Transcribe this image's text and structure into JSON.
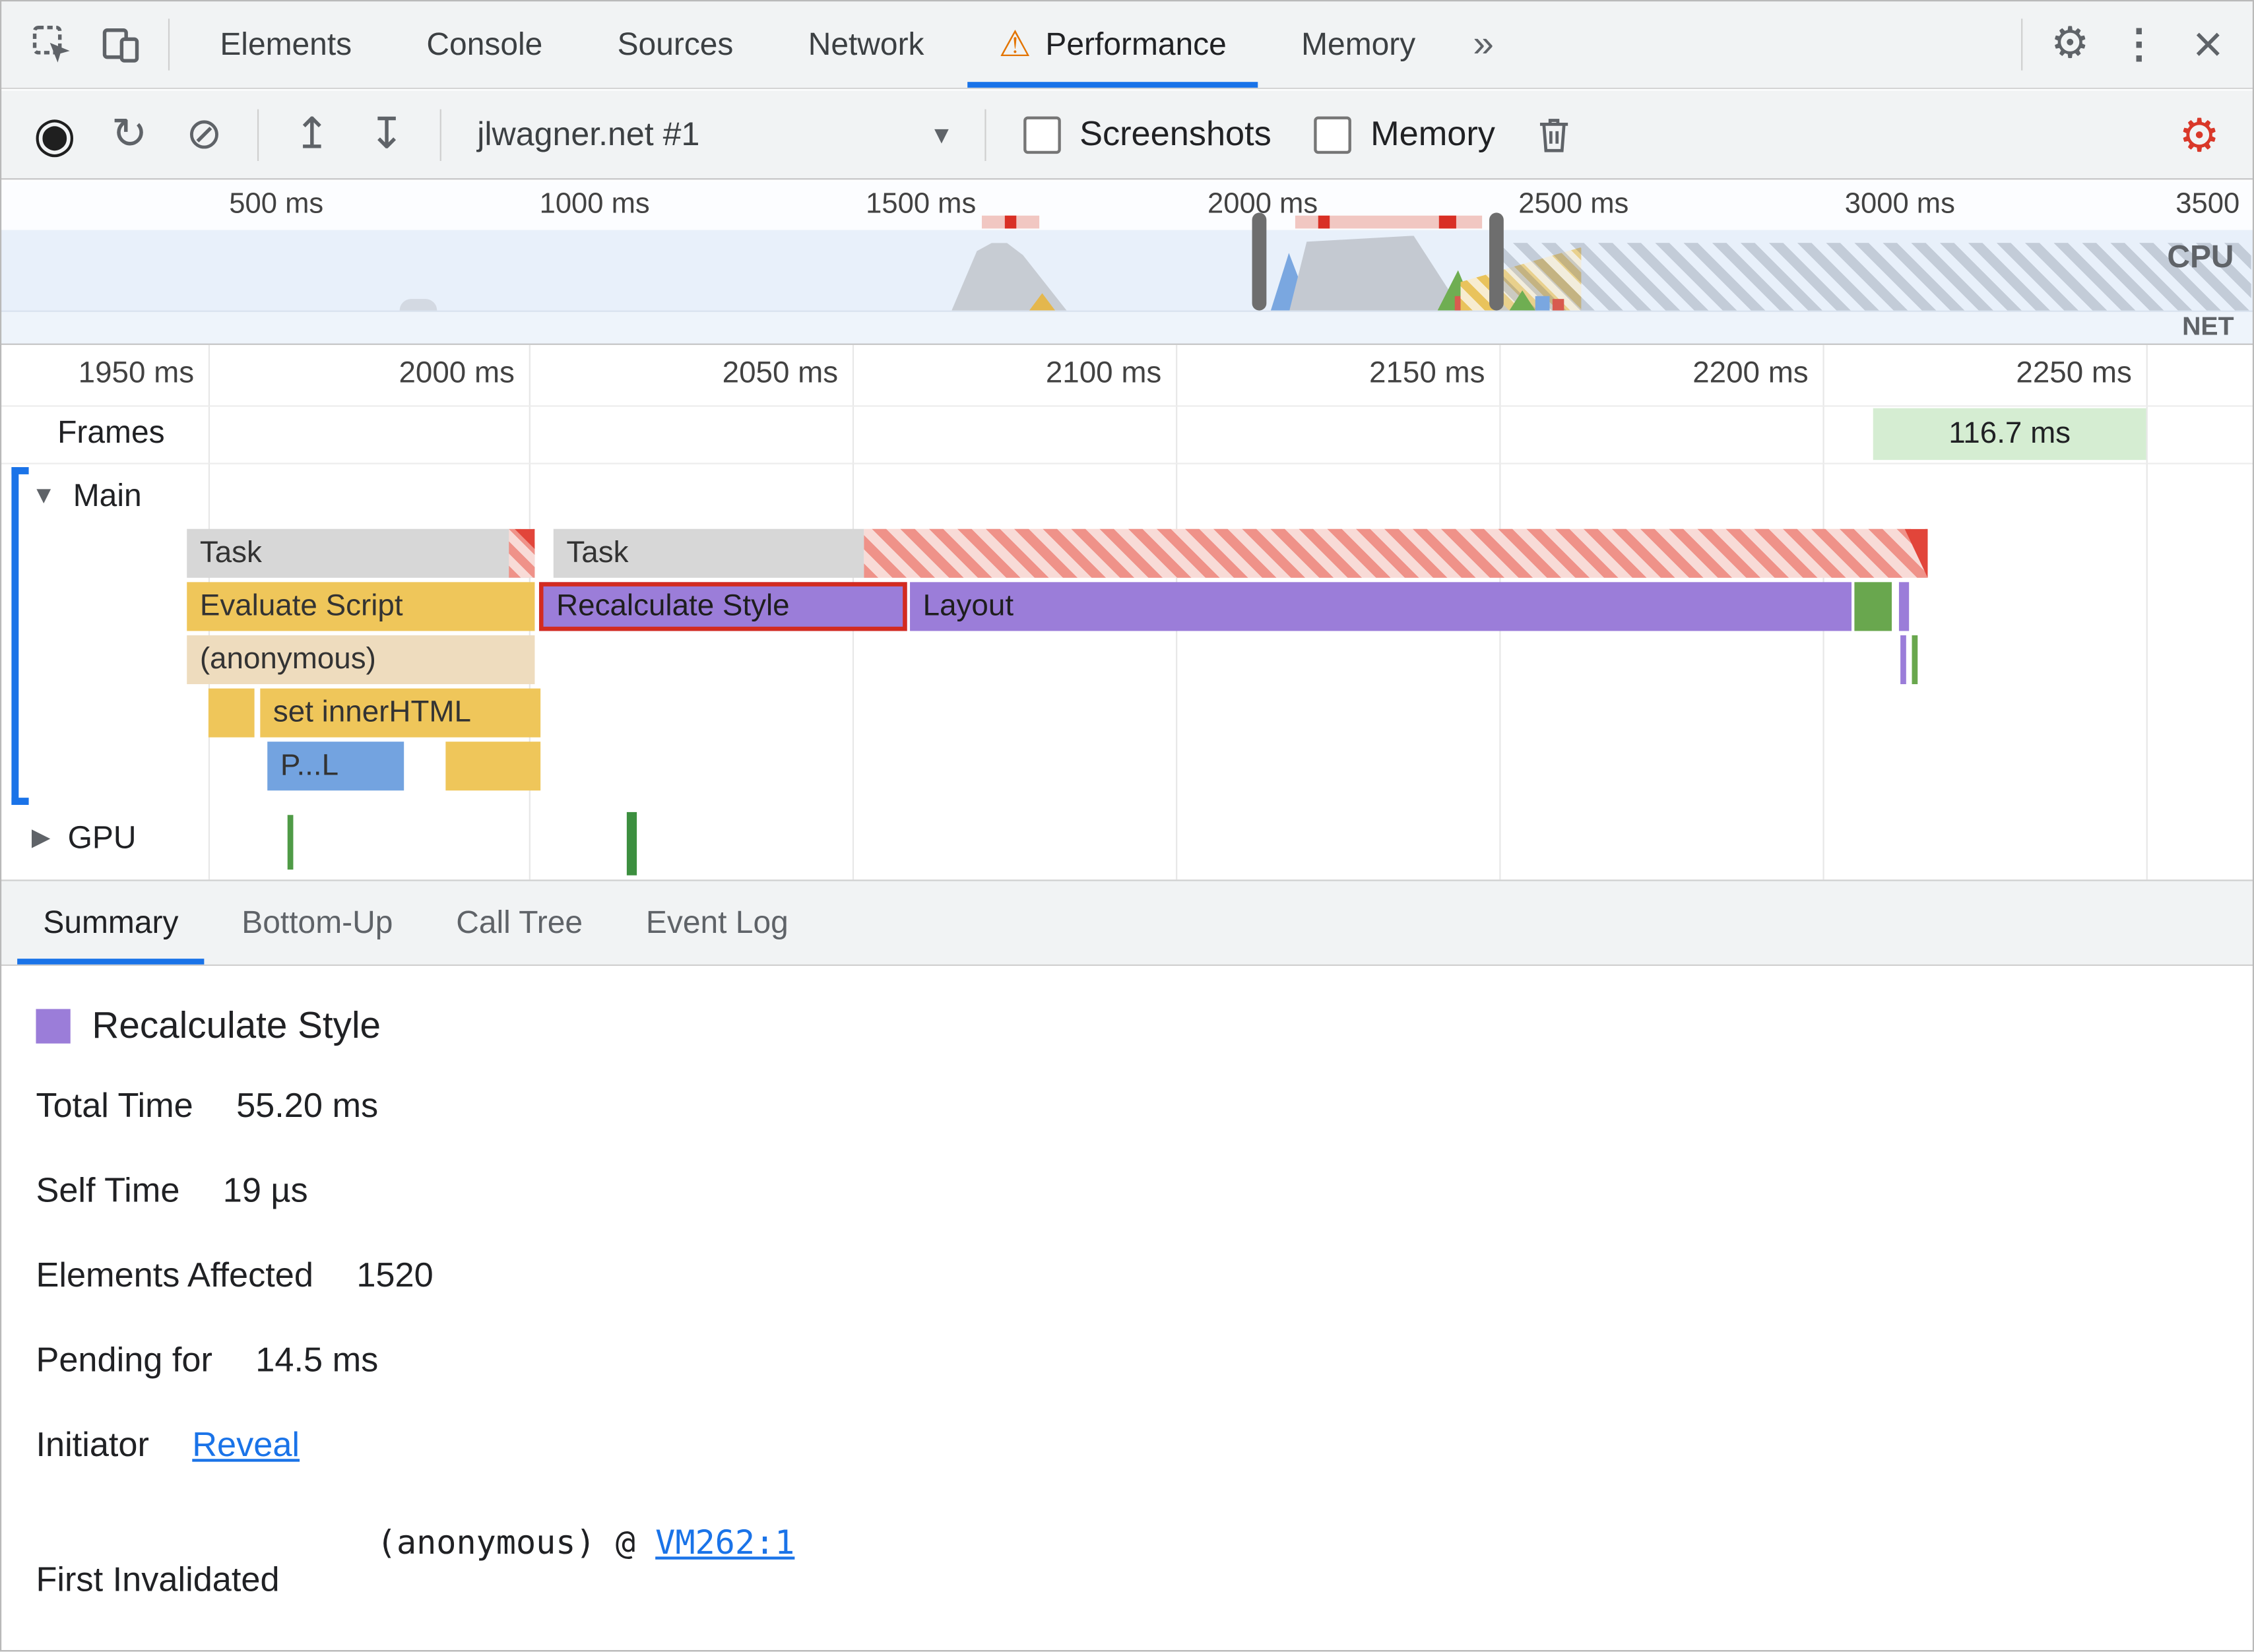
{
  "tab_bar": {
    "tabs": [
      "Elements",
      "Console",
      "Sources",
      "Network",
      "Performance",
      "Memory"
    ],
    "active_tab": "Performance"
  },
  "icons": {
    "overflow": "»",
    "gear": "⚙",
    "more": "⋮",
    "close": "×",
    "warning": "⚠",
    "record": "◉",
    "reload": "↻",
    "clear": "⊘",
    "load": "↥",
    "save": "↧",
    "dropdown": "▾",
    "main_expand": "▼",
    "gpu_collapse": "▶"
  },
  "toolbar": {
    "profile_select": "jlwagner.net #1",
    "screenshots_checkbox": {
      "label": "Screenshots",
      "checked": false
    },
    "memory_checkbox": {
      "label": "Memory",
      "checked": false
    }
  },
  "overview": {
    "ruler_labels": [
      "500 ms",
      "1000 ms",
      "1500 ms",
      "2000 ms",
      "2500 ms",
      "3000 ms",
      "3500"
    ],
    "cpu_label": "CPU",
    "net_label": "NET"
  },
  "timeline": {
    "ruler_labels": [
      "1950 ms",
      "2000 ms",
      "2050 ms",
      "2100 ms",
      "2150 ms",
      "2200 ms",
      "2250 ms"
    ],
    "frames_label": "Frames",
    "frame_duration": "116.7 ms",
    "main_track_label": "Main",
    "gpu_track_label": "GPU",
    "flame_bars": {
      "task1": "Task",
      "task2": "Task",
      "evaluate_script": "Evaluate Script",
      "recalculate_style": "Recalculate Style",
      "layout": "Layout",
      "anonymous": "(anonymous)",
      "set_inner_html": "set innerHTML",
      "parse_truncated": "P...L"
    }
  },
  "bottom_tabs": [
    "Summary",
    "Bottom-Up",
    "Call Tree",
    "Event Log"
  ],
  "active_bottom_tab": "Summary",
  "summary": {
    "legend_title": "Recalculate Style",
    "stats": [
      {
        "label": "Total Time",
        "value": "55.20 ms"
      },
      {
        "label": "Self Time",
        "value": "19 µs"
      },
      {
        "label": "Elements Affected",
        "value": "1520"
      },
      {
        "label": "Pending for",
        "value": "14.5 ms"
      }
    ],
    "initiator_label": "Initiator",
    "initiator_link": "Reveal",
    "first_invalidated_label": "First Invalidated",
    "first_invalidated_code": "(anonymous) @",
    "first_invalidated_link": "VM262:1"
  },
  "colors": {
    "accent_blue": "#1a73e8",
    "warning_orange": "#e37400",
    "capture_settings_red": "#d93829",
    "task_gray": "#d7d7d7",
    "scripting_yellow": "#efc65a",
    "style_purple": "#9b7dd9",
    "paint_green": "#69a74e",
    "loading_blue": "#73a3e0",
    "long_task_red": "#d93025",
    "frame_green": "#d5edd2"
  }
}
